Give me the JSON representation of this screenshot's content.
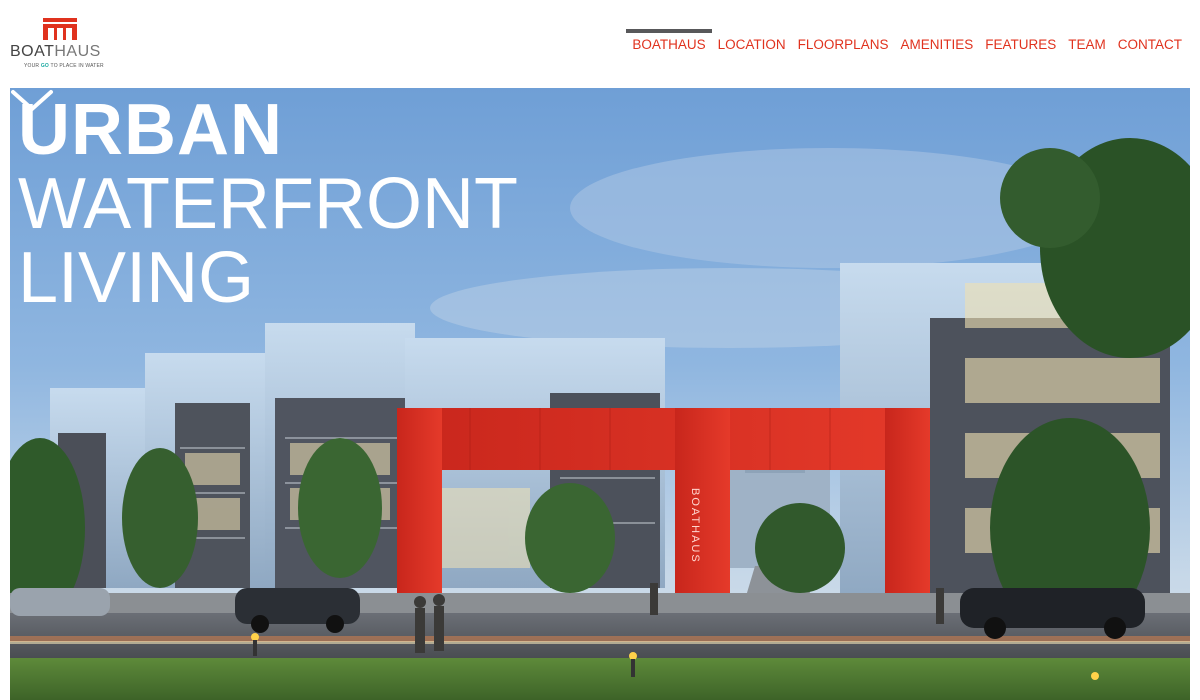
{
  "brand": {
    "name_part1": "BOAT",
    "name_part2": "HAUS",
    "tagline_before": "YOUR",
    "tagline_go": "GO",
    "tagline_after": "TO PLACE IN WATER",
    "mark_color": "#e0321e"
  },
  "nav": {
    "items": [
      {
        "label": "BOATHAUS",
        "active": true
      },
      {
        "label": "LOCATION"
      },
      {
        "label": "FLOORPLANS"
      },
      {
        "label": "AMENITIES"
      },
      {
        "label": "FEATURES"
      },
      {
        "label": "TEAM"
      },
      {
        "label": "CONTACT"
      }
    ],
    "color": "#e0321e",
    "active_indicator_color": "#58585a"
  },
  "hero": {
    "headline_line1": "URBAN",
    "headline_line2": "WATERFRONT",
    "headline_line3": "LIVING",
    "gate_sign": "BOATHAUS",
    "scroll_icon": "chevron-down-icon"
  }
}
